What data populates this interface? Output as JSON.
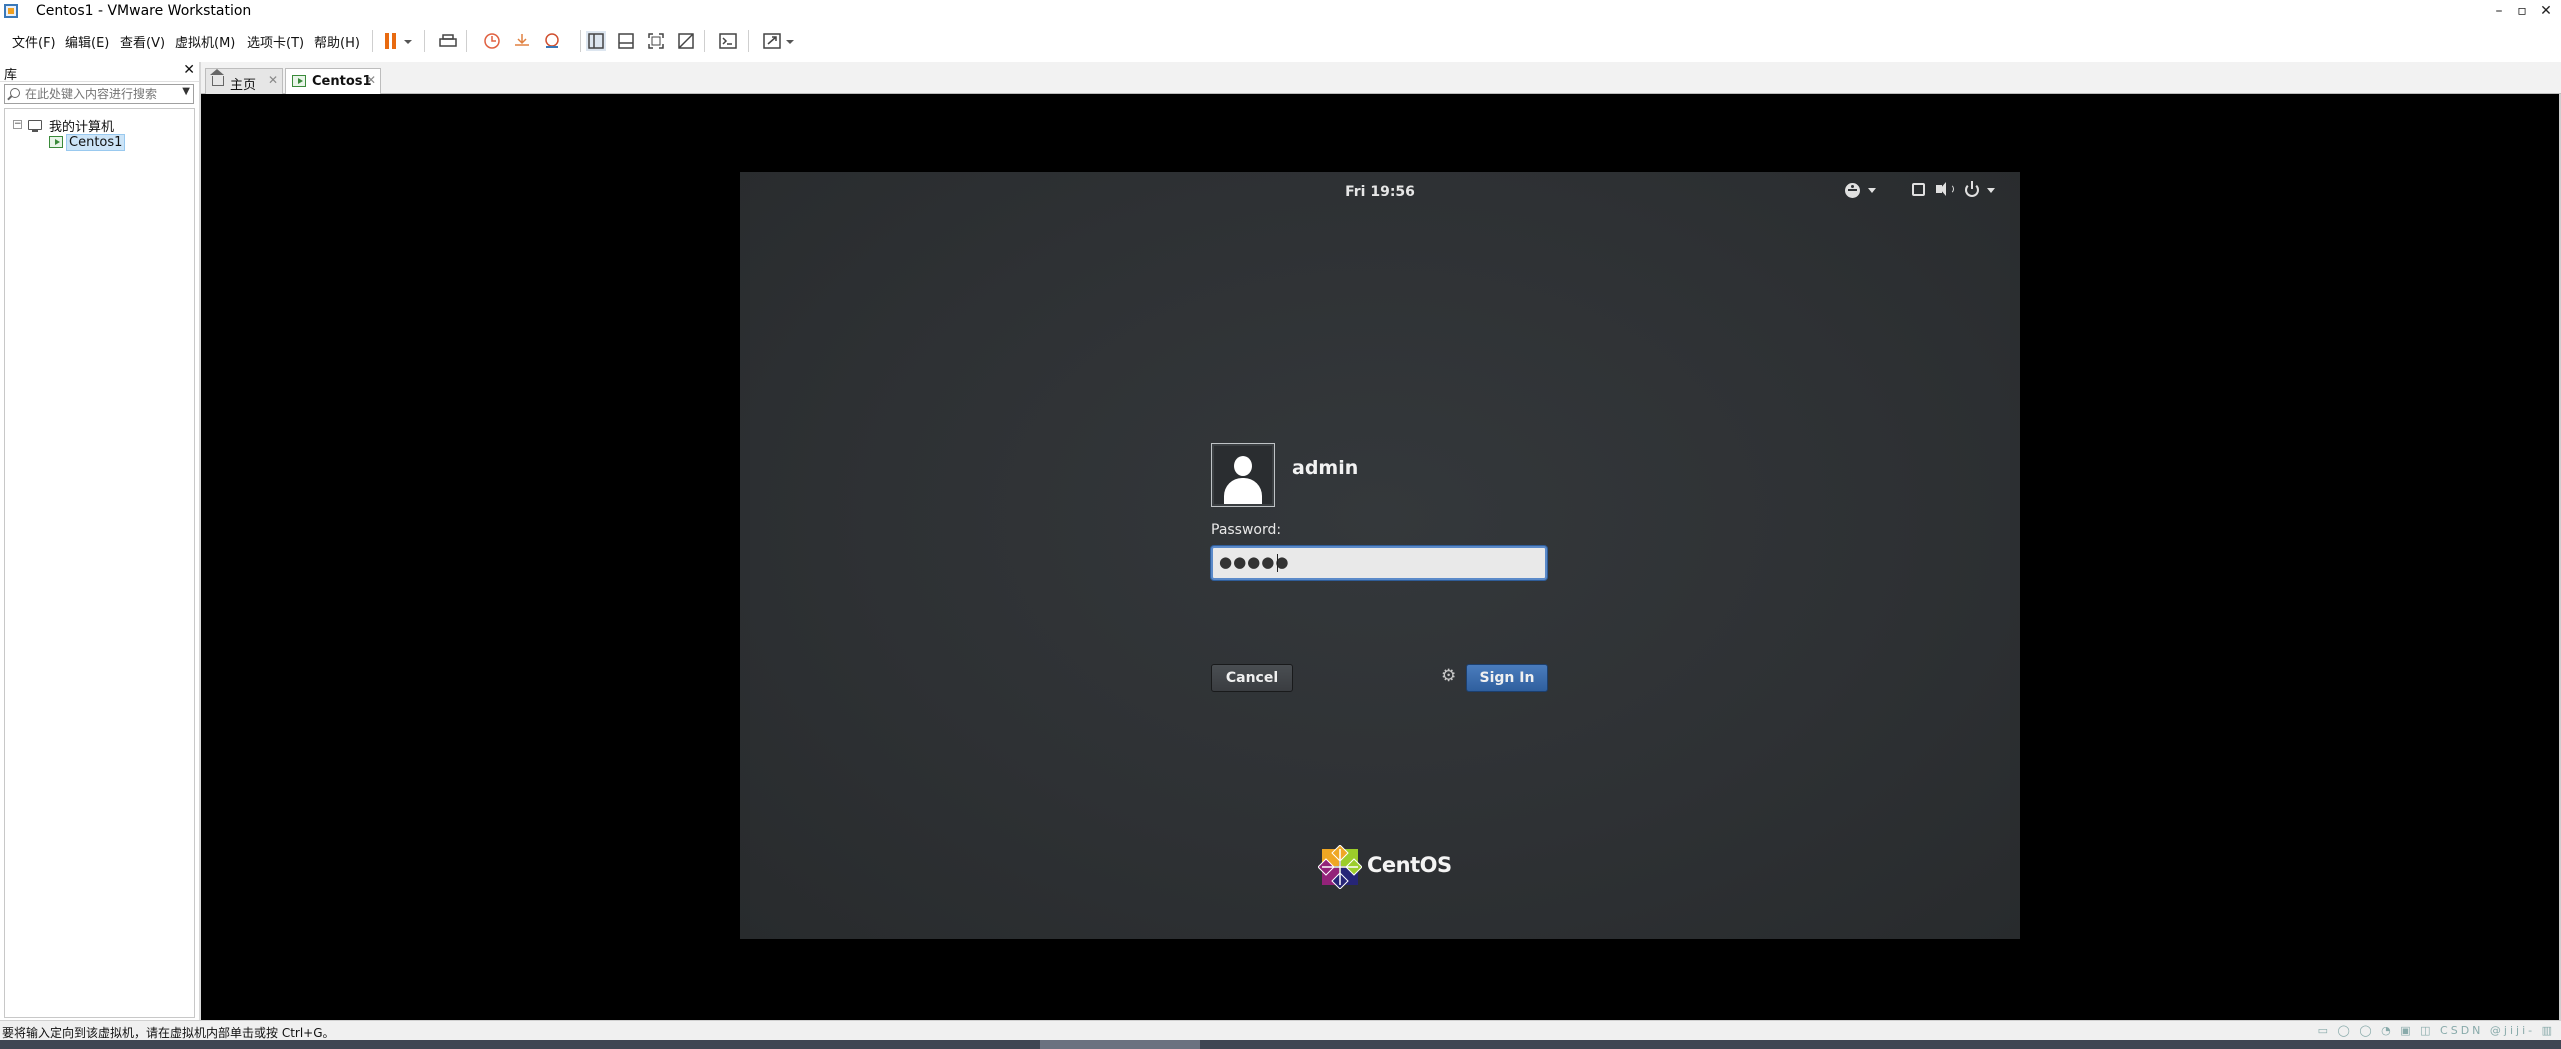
{
  "window": {
    "title": "Centos1 - VMware Workstation",
    "controls": [
      "–",
      "▫",
      "✕"
    ]
  },
  "menu": {
    "items": [
      "文件(F)",
      "编辑(E)",
      "查看(V)",
      "虚拟机(M)",
      "选项卡(T)",
      "帮助(H)"
    ]
  },
  "toolbar": {
    "icons": [
      "pause-icon",
      "send-ctrl-alt-del-icon",
      "snapshot-icon",
      "revert-snapshot-icon",
      "snapshot-manager-icon",
      "library-view-icon",
      "thumbnail-view-icon",
      "fullscreen-icon",
      "unity-icon",
      "console-icon",
      "stretch-icon"
    ],
    "accent_color": "#e86a10"
  },
  "library": {
    "title": "库",
    "close": "✕",
    "search_placeholder": "在此处键入内容进行搜索",
    "tree": {
      "root_label": "我的计算机",
      "root_toggle": "−",
      "children": [
        "Centos1"
      ]
    }
  },
  "tabs": [
    {
      "label": "主页",
      "close": "✕"
    },
    {
      "label": "Centos1",
      "close": "✕"
    }
  ],
  "guest": {
    "clock": "Fri 19:56",
    "username": "admin",
    "password_label": "Password:",
    "password_value": "●●●●●",
    "cancel_label": "Cancel",
    "signin_label": "Sign In",
    "brand": "CentOS",
    "signin_color": "#3a6eb0"
  },
  "status": {
    "text": "要将输入定向到该虚拟机，请在虚拟机内部单击或按 Ctrl+G。",
    "right_text": "CSDN @jiji-"
  }
}
